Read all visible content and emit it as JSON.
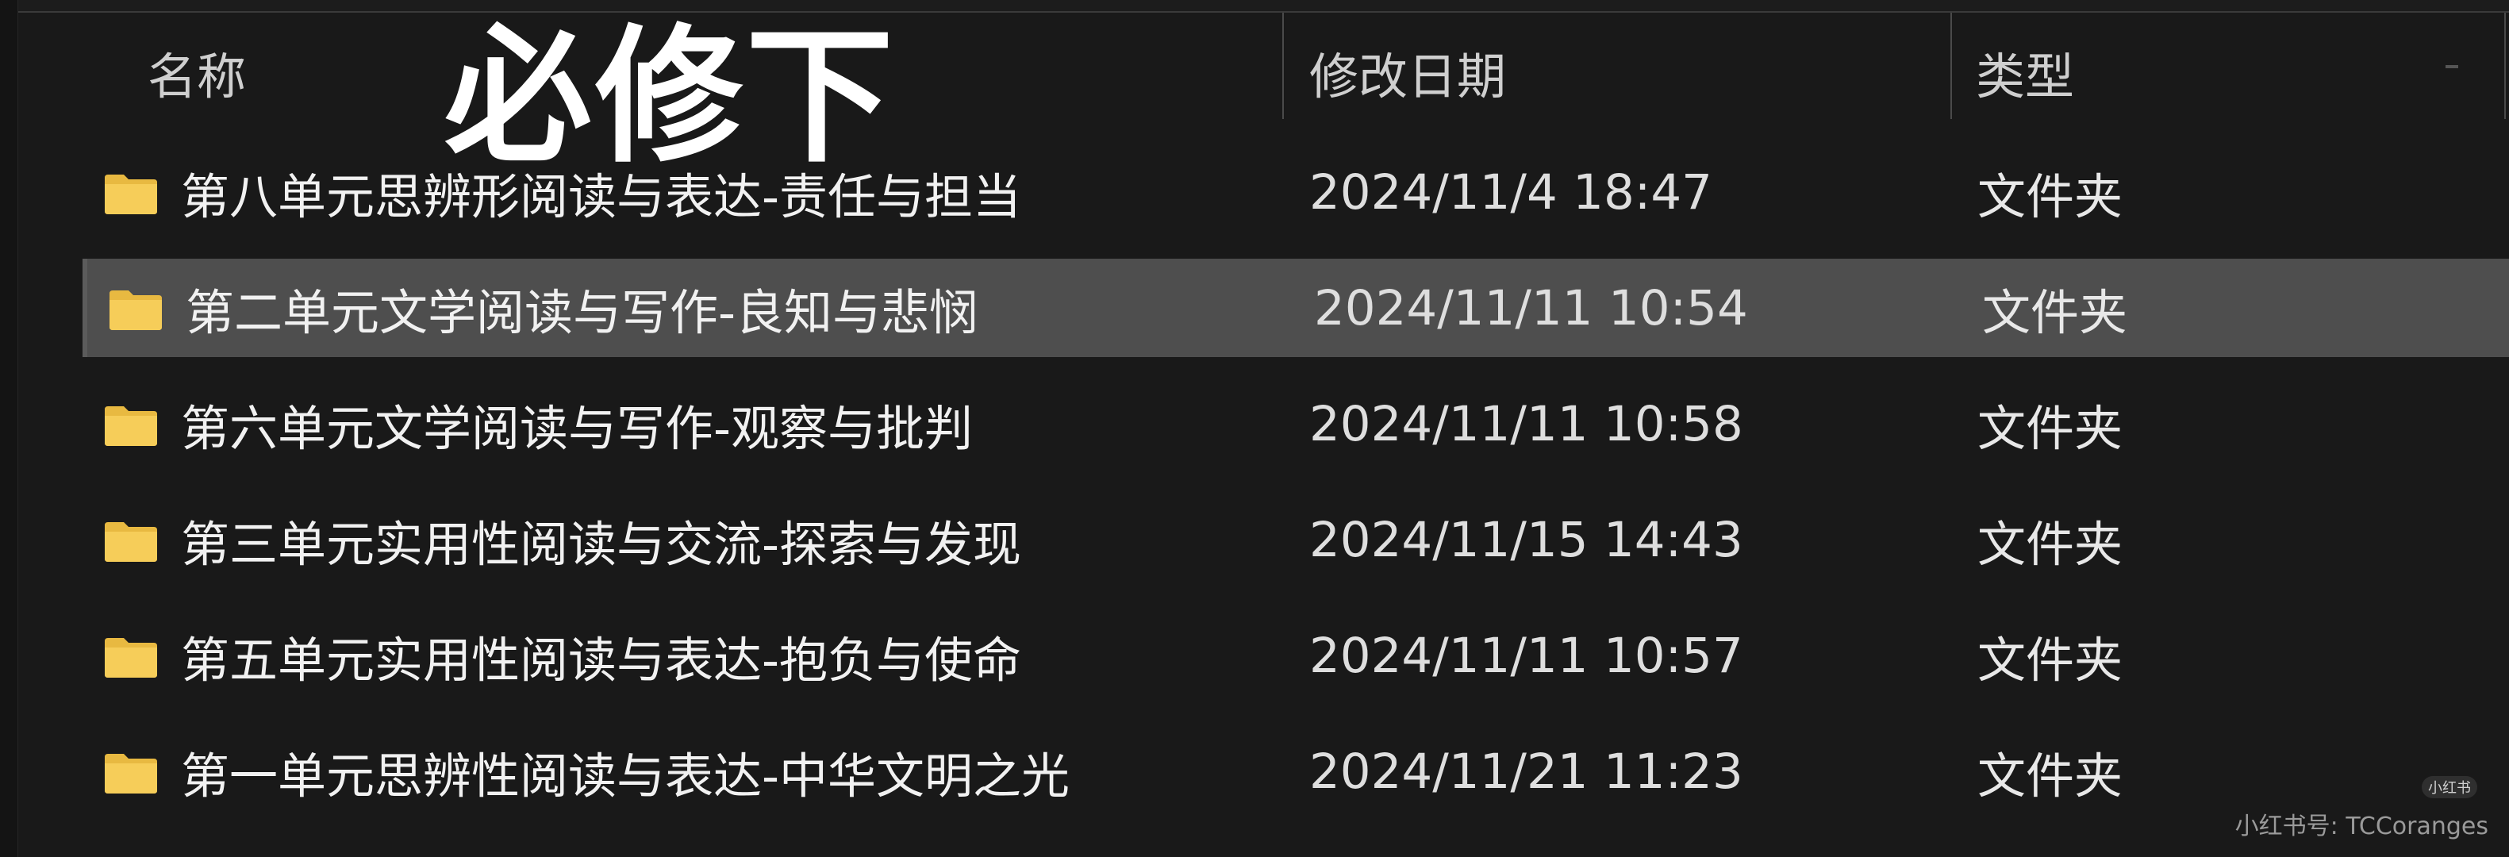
{
  "header": {
    "name_label": "名称",
    "date_label": "修改日期",
    "type_label": "类型"
  },
  "overlay": {
    "title": "必修下"
  },
  "files": [
    {
      "name": "第八单元思辨形阅读与表达-责任与担当",
      "date": "2024/11/4 18:47",
      "type": "文件夹",
      "icon": "folder-icon",
      "selected": false
    },
    {
      "name": "第二单元文学阅读与写作-良知与悲悯",
      "date": "2024/11/11 10:54",
      "type": "文件夹",
      "icon": "folder-icon",
      "selected": true
    },
    {
      "name": "第六单元文学阅读与写作-观察与批判",
      "date": "2024/11/11 10:58",
      "type": "文件夹",
      "icon": "folder-icon",
      "selected": false
    },
    {
      "name": "第三单元实用性阅读与交流-探索与发现",
      "date": "2024/11/15 14:43",
      "type": "文件夹",
      "icon": "folder-icon",
      "selected": false
    },
    {
      "name": "第五单元实用性阅读与表达-抱负与使命",
      "date": "2024/11/11 10:57",
      "type": "文件夹",
      "icon": "folder-icon",
      "selected": false
    },
    {
      "name": "第一单元思辨性阅读与表达-中华文明之光",
      "date": "2024/11/21 11:23",
      "type": "文件夹",
      "icon": "folder-icon",
      "selected": false
    }
  ],
  "watermark": {
    "badge": "小红书",
    "text": "小红书号: TCCoranges"
  },
  "colors": {
    "background": "#191919",
    "selected_row": "#4e4e4e",
    "folder": "#f2c94c",
    "text": "#f1f1f1"
  }
}
